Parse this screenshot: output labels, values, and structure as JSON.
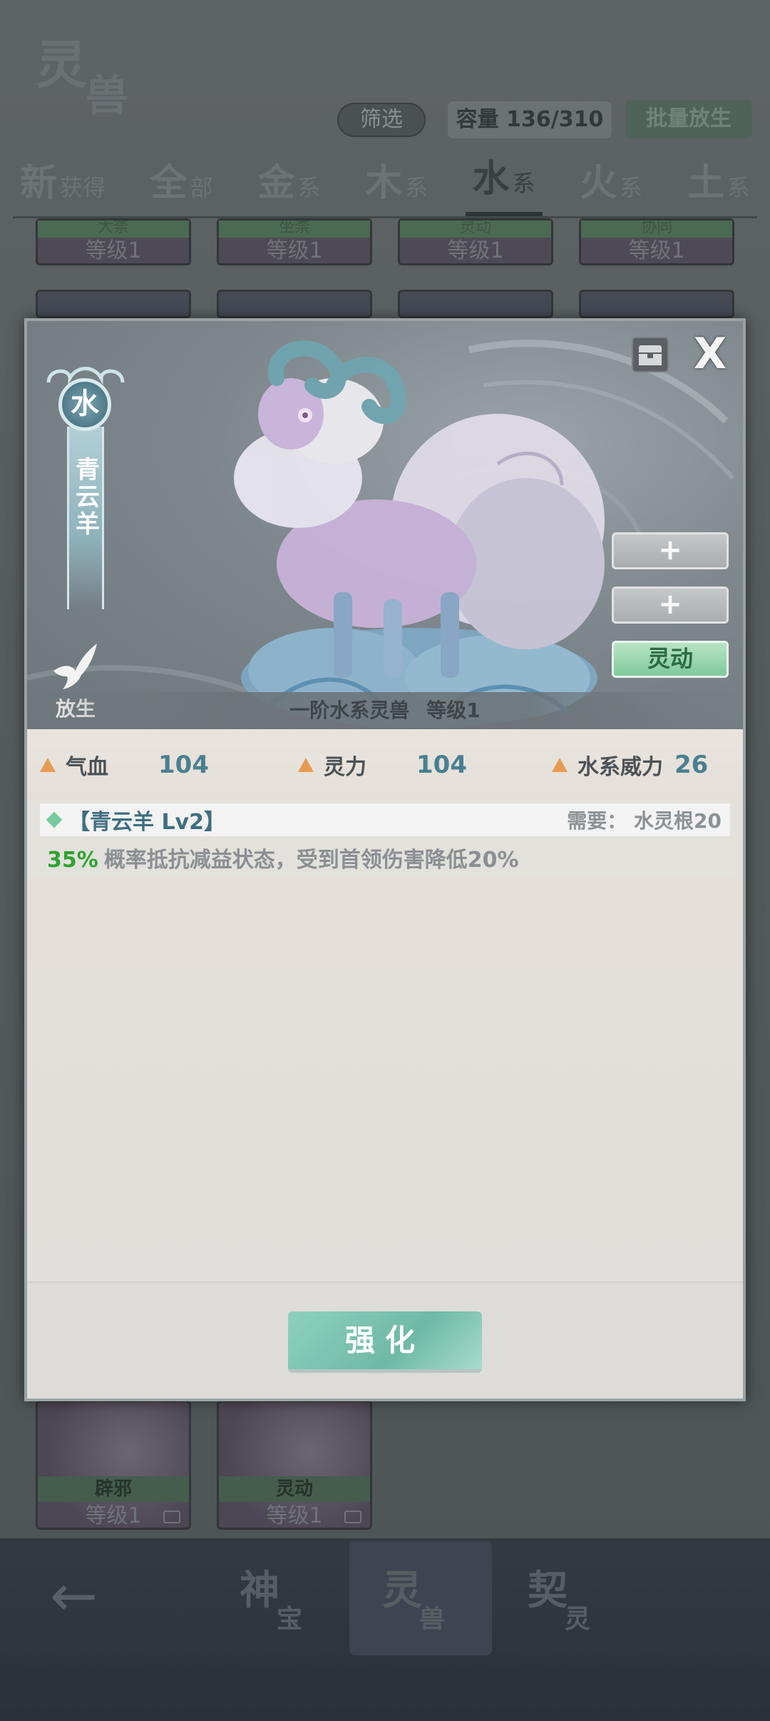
{
  "background": {
    "logo": {
      "char1": "灵",
      "char2": "兽"
    },
    "filter_label": "筛选",
    "capacity_label": "容量 136/310",
    "batch_release_label": "批量放生",
    "tabs": [
      {
        "big": "新",
        "small": "获得"
      },
      {
        "big": "全",
        "small": "部"
      },
      {
        "big": "金",
        "small": "系"
      },
      {
        "big": "木",
        "small": "系"
      },
      {
        "big": "水",
        "small": "系"
      },
      {
        "big": "火",
        "small": "系"
      },
      {
        "big": "土",
        "small": "系"
      }
    ],
    "top_cards": [
      {
        "name": "大柰",
        "level": "等级1"
      },
      {
        "name": "坐柰",
        "level": "等级1"
      },
      {
        "name": "灵动",
        "level": "等级1"
      },
      {
        "name": "协同",
        "level": "等级1"
      }
    ],
    "bottom_cards": [
      {
        "name": "辟邪",
        "level": "等级1"
      },
      {
        "name": "灵动",
        "level": "等级1"
      }
    ],
    "nav": [
      {
        "n1": "神",
        "n2": "宝"
      },
      {
        "n1": "灵",
        "n2": "兽"
      },
      {
        "n1": "契",
        "n2": "灵"
      }
    ],
    "back_icon": "←"
  },
  "modal": {
    "element": "水",
    "beast_name": "青云羊",
    "release_label": "放生",
    "close_label": "X",
    "side_buttons": [
      "+",
      "+",
      "灵动"
    ],
    "caption": {
      "tier": "一阶水系灵兽",
      "level": "等级1"
    },
    "stats": [
      {
        "label": "气血",
        "value": "104"
      },
      {
        "label": "灵力",
        "value": "104"
      },
      {
        "label": "水系威力",
        "value": "26"
      }
    ],
    "skill": {
      "title": "【青云羊 Lv2】",
      "requirement": "需要：  水灵根20",
      "percent": "35%",
      "description": "概率抵抗减益状态，受到首领伤害降低20%"
    },
    "upgrade_label": "强化"
  },
  "colors": {
    "accent_green": "#2ea32e",
    "stat_value": "#4a7f92",
    "stat_arrow": "#e79b52",
    "upgrade_button": "#6fb9a6"
  }
}
